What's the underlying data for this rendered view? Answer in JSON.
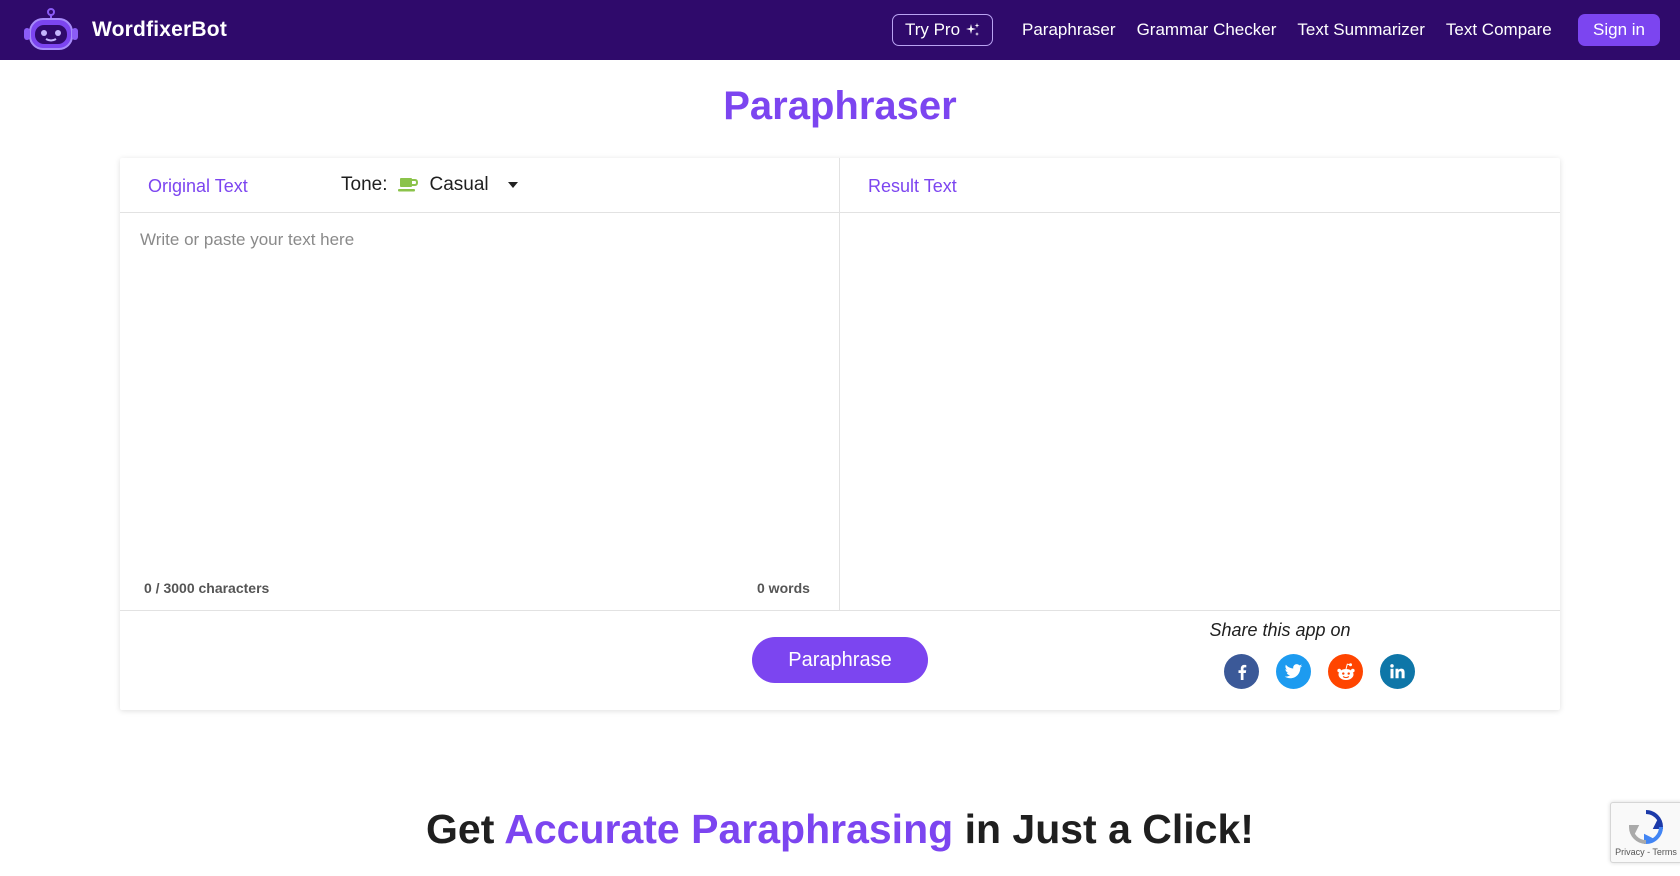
{
  "navbar": {
    "brand_name": "WordfixerBot",
    "try_pro_label": "Try Pro",
    "links": [
      "Paraphraser",
      "Grammar Checker",
      "Text Summarizer",
      "Text Compare"
    ],
    "signin_label": "Sign in"
  },
  "page": {
    "title": "Paraphraser"
  },
  "tool": {
    "original_label": "Original Text",
    "tone_label": "Tone:",
    "tone_value": "Casual",
    "result_label": "Result Text",
    "input_placeholder": "Write or paste your text here",
    "char_count": "0 / 3000 characters",
    "word_count": "0 words",
    "paraphrase_label": "Paraphrase"
  },
  "share": {
    "title": "Share this app on",
    "icons": [
      "facebook-icon",
      "twitter-icon",
      "reddit-icon",
      "linkedin-icon"
    ],
    "colors": {
      "facebook": "#3b5998",
      "twitter": "#1d9bf0",
      "reddit": "#ff4500",
      "linkedin": "#0e76a8"
    }
  },
  "headline": {
    "prefix": "Get",
    "accent": "Accurate Paraphrasing",
    "suffix": "in Just a Click!"
  },
  "recaptcha": {
    "links": "Privacy - Terms"
  },
  "colors": {
    "navbar_bg": "#2f0a6b",
    "accent": "#7c45f0"
  }
}
